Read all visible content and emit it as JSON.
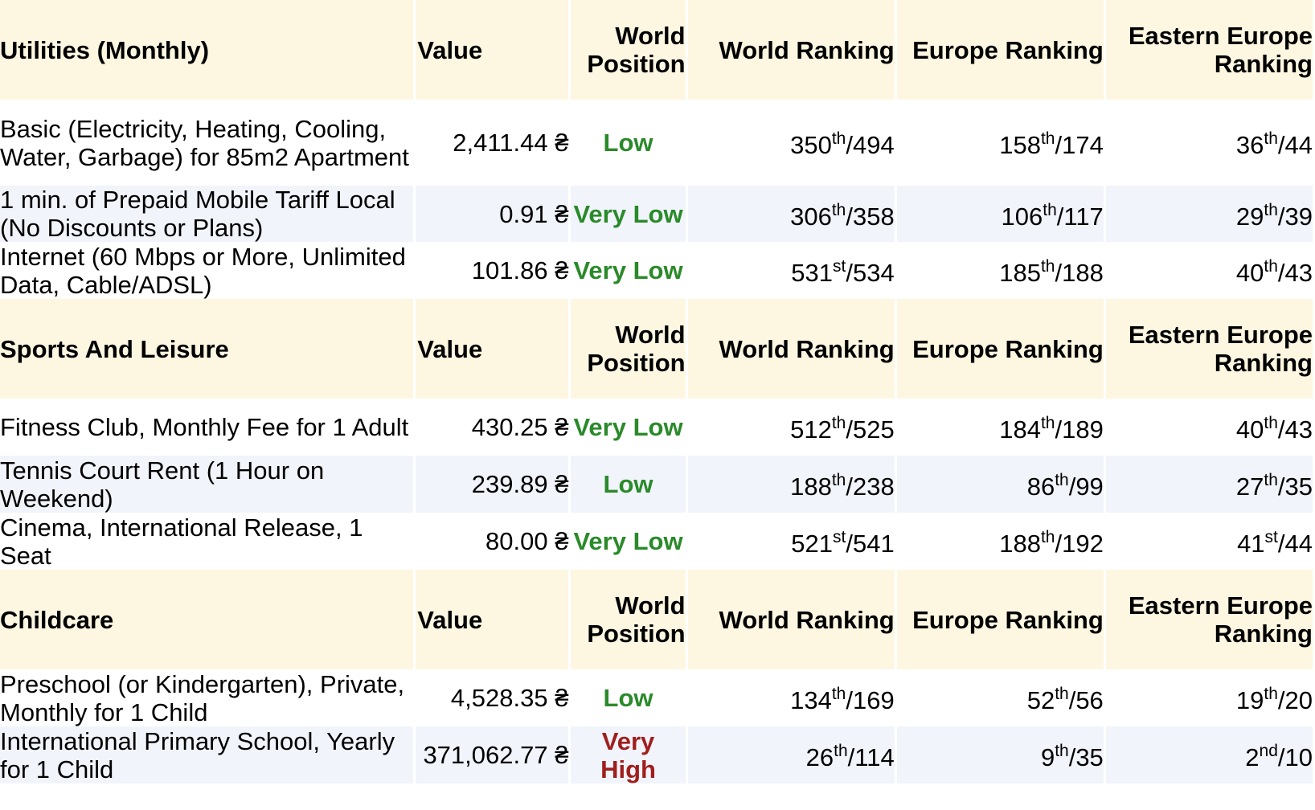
{
  "columns": {
    "value": "Value",
    "world_position": "World Position",
    "world_ranking": "World Ranking",
    "europe_ranking": "Europe Ranking",
    "eastern_europe_ranking": "Eastern Europe Ranking"
  },
  "colors": {
    "low": "#2a8a2a",
    "very_low": "#2a8a2a",
    "very_high": "#a01e1e",
    "header_bg": "#fdf6e1",
    "alt_row_bg": "#f1f4fa"
  },
  "sections": [
    {
      "title": "Utilities (Monthly)",
      "rows": [
        {
          "item": "Basic (Electricity, Heating, Cooling, Water, Garbage) for 85m2 Apartment",
          "value": "2,411.44 ₴",
          "position": "Low",
          "world": [
            "350",
            "th",
            "/494"
          ],
          "europe": [
            "158",
            "th",
            "/174"
          ],
          "eastern": [
            "36",
            "th",
            "/44"
          ]
        },
        {
          "item": "1 min. of Prepaid Mobile Tariff Local (No Discounts or Plans)",
          "value": "0.91 ₴",
          "position": "Very Low",
          "world": [
            "306",
            "th",
            "/358"
          ],
          "europe": [
            "106",
            "th",
            "/117"
          ],
          "eastern": [
            "29",
            "th",
            "/39"
          ]
        },
        {
          "item": "Internet (60 Mbps or More, Unlimited Data, Cable/ADSL)",
          "value": "101.86 ₴",
          "position": "Very Low",
          "world": [
            "531",
            "st",
            "/534"
          ],
          "europe": [
            "185",
            "th",
            "/188"
          ],
          "eastern": [
            "40",
            "th",
            "/43"
          ]
        }
      ]
    },
    {
      "title": "Sports And Leisure",
      "rows": [
        {
          "item": "Fitness Club, Monthly Fee for 1 Adult",
          "value": "430.25 ₴",
          "position": "Very Low",
          "world": [
            "512",
            "th",
            "/525"
          ],
          "europe": [
            "184",
            "th",
            "/189"
          ],
          "eastern": [
            "40",
            "th",
            "/43"
          ]
        },
        {
          "item": "Tennis Court Rent (1 Hour on Weekend)",
          "value": "239.89 ₴",
          "position": "Low",
          "world": [
            "188",
            "th",
            "/238"
          ],
          "europe": [
            "86",
            "th",
            "/99"
          ],
          "eastern": [
            "27",
            "th",
            "/35"
          ]
        },
        {
          "item": "Cinema, International Release, 1 Seat",
          "value": "80.00 ₴",
          "position": "Very Low",
          "world": [
            "521",
            "st",
            "/541"
          ],
          "europe": [
            "188",
            "th",
            "/192"
          ],
          "eastern": [
            "41",
            "st",
            "/44"
          ]
        }
      ]
    },
    {
      "title": "Childcare",
      "rows": [
        {
          "item": "Preschool (or Kindergarten), Private, Monthly for 1 Child",
          "value": "4,528.35 ₴",
          "position": "Low",
          "world": [
            "134",
            "th",
            "/169"
          ],
          "europe": [
            "52",
            "th",
            "/56"
          ],
          "eastern": [
            "19",
            "th",
            "/20"
          ]
        },
        {
          "item": "International Primary School, Yearly for 1 Child",
          "value": "371,062.77 ₴",
          "position": "Very High",
          "world": [
            "26",
            "th",
            "/114"
          ],
          "europe": [
            "9",
            "th",
            "/35"
          ],
          "eastern": [
            "2",
            "nd",
            "/10"
          ]
        }
      ]
    }
  ]
}
